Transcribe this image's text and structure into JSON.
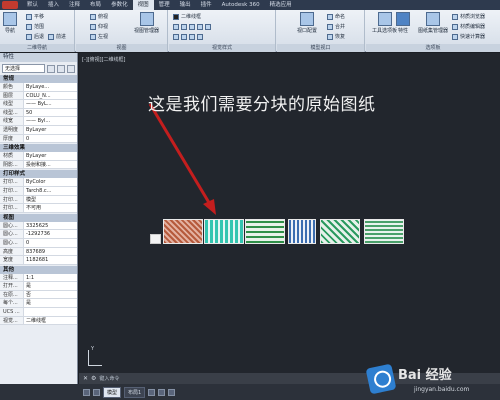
{
  "ribbon": {
    "tabs": [
      "默认",
      "插入",
      "注释",
      "布局",
      "参数化",
      "视图",
      "管理",
      "输出",
      "插件",
      "Autodesk 360",
      "精选应用"
    ],
    "active_tab": "视图",
    "panels": [
      {
        "title": "二维导航",
        "buttons": [
          "平移",
          "范围",
          "后退",
          "前进"
        ]
      },
      {
        "title": "视图",
        "buttons": [
          "俯视",
          "仰视",
          "左视",
          "视图管理器"
        ]
      },
      {
        "title": "视觉样式",
        "buttons": [
          "二维线框"
        ]
      },
      {
        "title": "模型视口",
        "buttons": [
          "视口配置",
          "命名",
          "合并",
          "恢复"
        ]
      },
      {
        "title": "选项板",
        "buttons": [
          "工具选项板",
          "特性",
          "图纸集管理器",
          "材质浏览器",
          "材质编辑器",
          "快速计算器"
        ]
      }
    ],
    "nav_buttons": [
      "导航"
    ]
  },
  "palette": {
    "title": "特性",
    "selector": "无选择",
    "sections": [
      {
        "name": "常规",
        "rows": [
          {
            "k": "颜色",
            "v": "ByLaye..."
          },
          {
            "k": "图层",
            "v": "COLU_N..."
          },
          {
            "k": "线型",
            "v": "—— ByL..."
          },
          {
            "k": "线型...",
            "v": "50"
          },
          {
            "k": "线宽",
            "v": "—— Byl..."
          },
          {
            "k": "透明度",
            "v": "ByLayer"
          },
          {
            "k": "厚度",
            "v": "0"
          }
        ]
      },
      {
        "name": "三维效果",
        "rows": [
          {
            "k": "材质",
            "v": "ByLayer"
          },
          {
            "k": "阴影...",
            "v": "投射和接..."
          }
        ]
      },
      {
        "name": "打印样式",
        "rows": [
          {
            "k": "打印...",
            "v": "ByColor"
          },
          {
            "k": "打印...",
            "v": "Tarch8.c..."
          },
          {
            "k": "打印...",
            "v": "模型"
          },
          {
            "k": "打印...",
            "v": "不可用"
          }
        ]
      },
      {
        "name": "视图",
        "rows": [
          {
            "k": "圆心...",
            "v": "3325625"
          },
          {
            "k": "圆心...",
            "v": "-1292736"
          },
          {
            "k": "圆心...",
            "v": "0"
          },
          {
            "k": "高度",
            "v": "837689"
          },
          {
            "k": "宽度",
            "v": "1182681"
          }
        ]
      },
      {
        "name": "其他",
        "rows": [
          {
            "k": "注释...",
            "v": "1:1"
          },
          {
            "k": "打开...",
            "v": "是"
          },
          {
            "k": "在原...",
            "v": "否"
          },
          {
            "k": "每个...",
            "v": "是"
          },
          {
            "k": "UCS ...",
            "v": ""
          },
          {
            "k": "视觉...",
            "v": "二维线框"
          }
        ]
      }
    ]
  },
  "canvas": {
    "view_label": "[-][俯视][二维线框]",
    "annotation": "这是我们需要分块的原始图纸",
    "ucs_y": "Y"
  },
  "command": {
    "text": "键入命令"
  },
  "status": {
    "layouts": [
      "模型",
      "布局1"
    ],
    "active_layout": "模型"
  },
  "watermark": {
    "text": "Bai 经验",
    "sub": "jingyan.baidu.com"
  },
  "colors": {
    "canvas_bg": "#22262d",
    "ribbon_tab_bg": "#2e3a4e",
    "arrow": "#c41e1e"
  }
}
